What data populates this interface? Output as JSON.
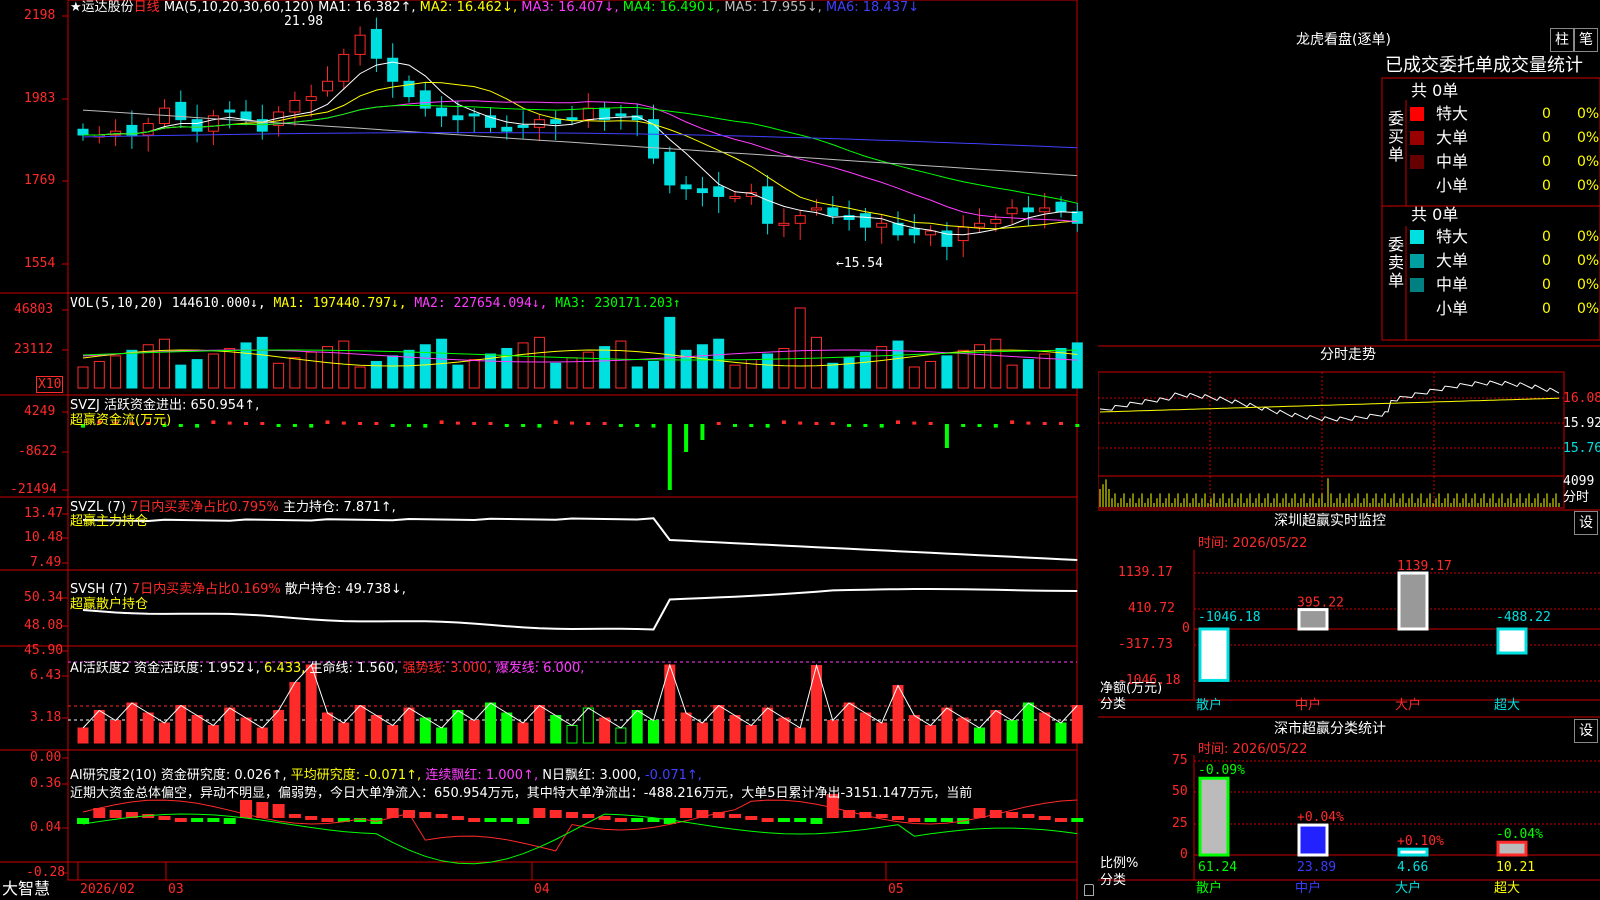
{
  "stock": {
    "name": "运达股份",
    "period": "日线",
    "star": "★"
  },
  "colors": {
    "up": "#ff2a2a",
    "down": "#00e0e0",
    "grid": "#cc0000",
    "yellow": "#ffff00",
    "magenta": "#ff3dff",
    "green": "#00ff00",
    "blue": "#4040ff",
    "white": "#ffffff",
    "gray": "#bdbdbd"
  },
  "price_panel": {
    "ma_params": "MA(5,10,20,30,60,120)",
    "ma": [
      {
        "label": "MA1:",
        "value": "16.382",
        "arrow": "↑",
        "color": "#ffffff"
      },
      {
        "label": "MA2:",
        "value": "16.462",
        "arrow": "↓",
        "color": "#ffff00"
      },
      {
        "label": "MA3:",
        "value": "16.407",
        "arrow": "↓",
        "color": "#ff3dff"
      },
      {
        "label": "MA4:",
        "value": "16.490",
        "arrow": "↓",
        "color": "#00ff00"
      },
      {
        "label": "MA5:",
        "value": "17.955",
        "arrow": "↓",
        "color": "#bdbdbd"
      },
      {
        "label": "MA6:",
        "value": "18.437",
        "arrow": "↓",
        "color": "#4040ff"
      }
    ],
    "y_ticks": [
      "2198",
      "1983",
      "1769",
      "1554"
    ],
    "high_mark": "21.98",
    "low_mark": "←15.54",
    "ylim": [
      15.2,
      22.3
    ]
  },
  "vol_panel": {
    "header": "VOL(5,10,20)",
    "value": "144610.000",
    "ma": [
      {
        "label": "MA1:",
        "value": "197440.797",
        "arrow": "↓",
        "color": "#ffff00"
      },
      {
        "label": "MA2:",
        "value": "227654.094",
        "arrow": "↓",
        "color": "#ff3dff"
      },
      {
        "label": "MA3:",
        "value": "230171.203",
        "arrow": "↑",
        "color": "#00ff00"
      }
    ],
    "y_ticks": [
      "46803",
      "23112"
    ],
    "unit": "X10"
  },
  "svzj_panel": {
    "line1": "SVZJ  活跃资金进出: 650.954↑,",
    "line2": "超赢资金流(万元)",
    "y_ticks": [
      "4249",
      "-8622",
      "-21494"
    ]
  },
  "svzl_panel": {
    "prefix": "SVZL (7)",
    "ratio": "7日内买卖净占比0.795%",
    "hold": "主力持仓: 7.871↑,",
    "line2": "超赢主力持仓",
    "y_ticks": [
      "13.47",
      "10.48",
      "7.49"
    ]
  },
  "svsh_panel": {
    "prefix": "SVSH (7)",
    "ratio": "7日内买卖净占比0.169%",
    "hold": "散户持仓: 49.738↓,",
    "line2": "超赢散户持仓",
    "y_ticks": [
      "50.34",
      "48.08",
      "45.90"
    ]
  },
  "ai_active_panel": {
    "title": "AI活跃度2",
    "active": "资金活跃度: 1.952↓,",
    "v2": "6.433,",
    "life": "生命线: 1.560,",
    "strong": "强势线: 3.000,",
    "burst": "爆发线: 6.000,",
    "y_ticks": [
      "6.43",
      "3.18",
      "0.00"
    ]
  },
  "ai_research_panel": {
    "title": "AI研究度2(10)",
    "research": "资金研究度: 0.026↑,",
    "avg": "平均研究度: -0.071↑,",
    "cont": "连续飘红: 1.000↑,",
    "nday": "N日飘红: 3.000,",
    "last": "-0.071↑,",
    "summary": "近期大资金总体偏空，异动不明显，偏弱势，今日大单净流入：650.954万元，其中特大单净流出：-488.216万元，大单5日累计净出-3151.147万元，当前",
    "y_ticks": [
      "0.36",
      "0.04",
      "-0.28"
    ]
  },
  "time_axis": {
    "logo": "大智慧",
    "labels": [
      "2026/02",
      "03",
      "04",
      "05"
    ]
  },
  "dragon_tiger": {
    "title": "龙虎看盘(逐单)",
    "btn_pillar": "柱",
    "btn_count": "笔",
    "stat_title": "已成交委托单成交量统计",
    "buy": {
      "side": "委买单",
      "total": "共 0单",
      "rows": [
        {
          "label": "特大",
          "count": "0",
          "pct": "0%",
          "color": "#ff0000"
        },
        {
          "label": "大单",
          "count": "0",
          "pct": "0%",
          "color": "#990000"
        },
        {
          "label": "中单",
          "count": "0",
          "pct": "0%",
          "color": "#660000"
        },
        {
          "label": "小单",
          "count": "0",
          "pct": "0%",
          "color": ""
        }
      ]
    },
    "sell": {
      "side": "委卖单",
      "total": "共 0单",
      "rows": [
        {
          "label": "特大",
          "count": "0",
          "pct": "0%",
          "color": "#00e0e0"
        },
        {
          "label": "大单",
          "count": "0",
          "pct": "0%",
          "color": "#00a0a0"
        },
        {
          "label": "中单",
          "count": "0",
          "pct": "0%",
          "color": "#008080"
        },
        {
          "label": "小单",
          "count": "0",
          "pct": "0%",
          "color": ""
        }
      ]
    }
  },
  "intraday": {
    "title": "分时走势",
    "prices": [
      "16.08",
      "15.92",
      "15.76"
    ],
    "volume": "4099",
    "vol_label": "分时"
  },
  "realtime_monitor": {
    "title": "深圳超赢实时监控",
    "btn": "设",
    "time": "时间: 2026/05/22",
    "y_ticks": [
      "1139.17",
      "410.72",
      "0",
      "-317.73",
      "-1046.18"
    ],
    "unit": "净额(万元)",
    "x_title": "分类",
    "categories": [
      "散户",
      "中户",
      "大户",
      "超大"
    ],
    "values": [
      -1046.18,
      395.22,
      1139.17,
      -488.22
    ],
    "value_labels": [
      "-1046.18",
      "395.22",
      "1139.17",
      "-488.22"
    ]
  },
  "class_stats": {
    "title": "深市超赢分类统计",
    "btn": "设",
    "time": "时间: 2026/05/22",
    "y_ticks": [
      "75",
      "50",
      "25",
      "0"
    ],
    "unit": "比例%",
    "x_title": "分类",
    "categories": [
      "散户",
      "中户",
      "大户",
      "超大"
    ],
    "values": [
      61.24,
      23.89,
      4.66,
      10.21
    ],
    "value_labels": [
      "61.24",
      "23.89",
      "4.66",
      "10.21"
    ],
    "changes": [
      "-0.09%",
      "+0.04%",
      "+0.10%",
      "-0.04%"
    ]
  }
}
